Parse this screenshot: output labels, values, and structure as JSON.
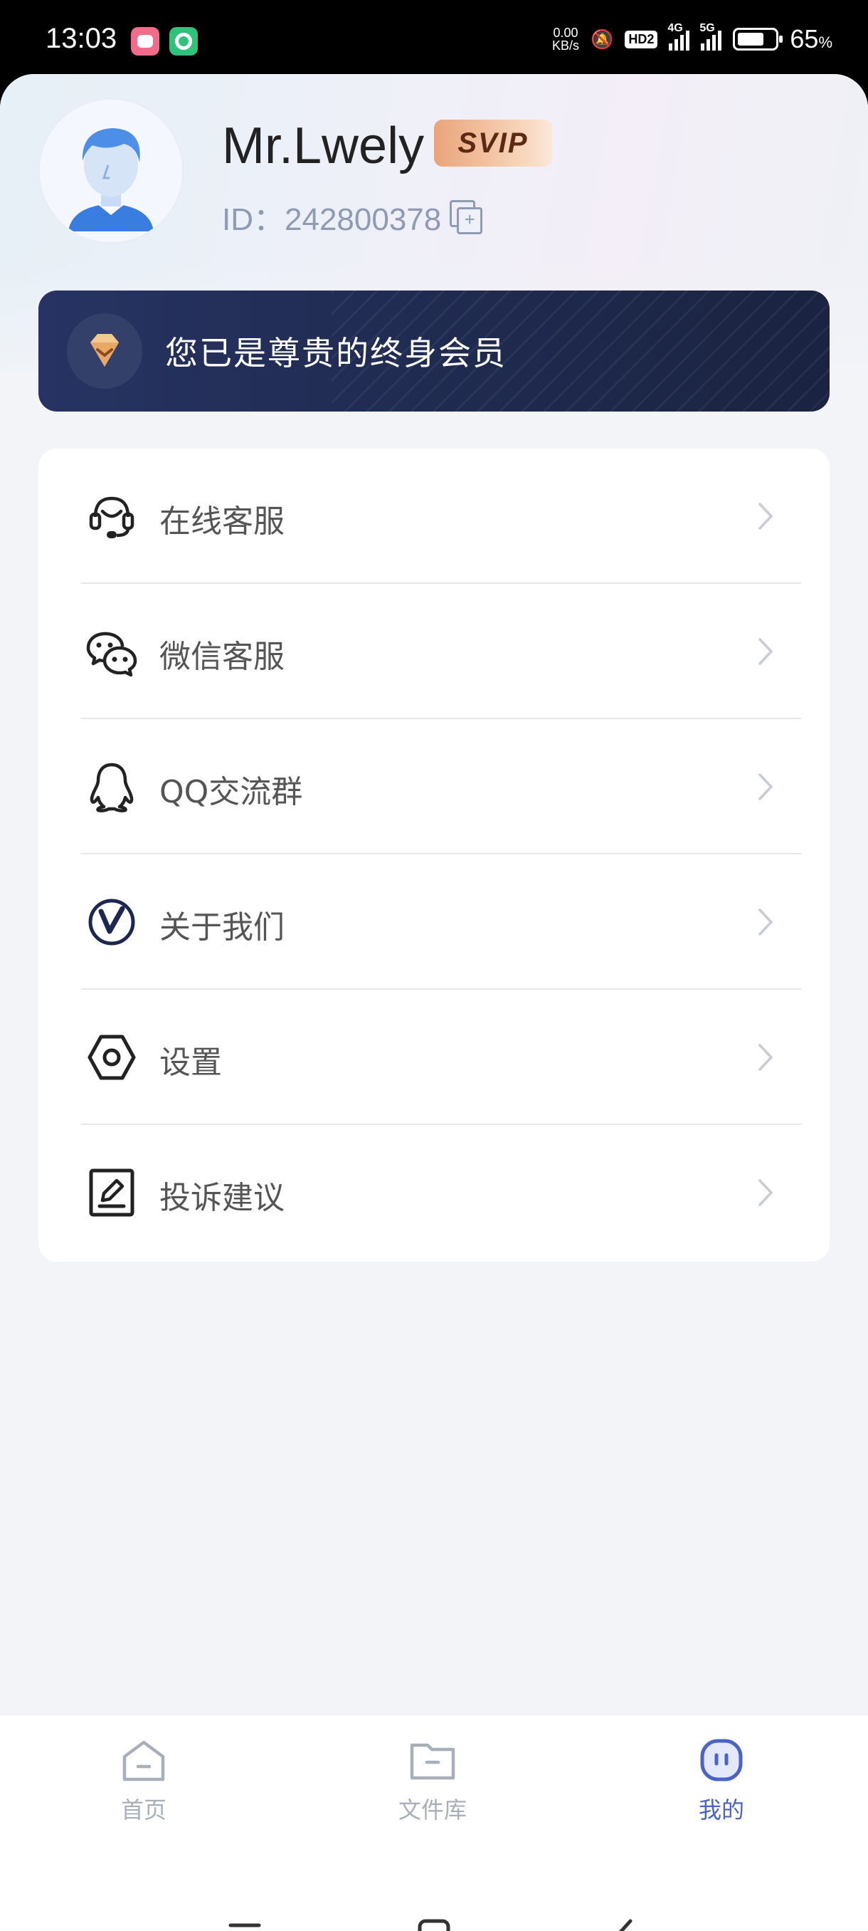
{
  "status_bar": {
    "time": "13:03",
    "net_speed_value": "0.00",
    "net_speed_unit": "KB/s",
    "hd_label": "HD2",
    "net1": "4G",
    "net2": "5G",
    "battery_percent": "65",
    "battery_unit": "%"
  },
  "profile": {
    "username": "Mr.Lwely",
    "badge": "SVIP",
    "user_id": "ID：242800378"
  },
  "vip_banner": {
    "text": "您已是尊贵的终身会员"
  },
  "menu": {
    "items": [
      {
        "label": "在线客服",
        "icon": "headset-icon"
      },
      {
        "label": "微信客服",
        "icon": "wechat-icon"
      },
      {
        "label": "QQ交流群",
        "icon": "qq-penguin-icon"
      },
      {
        "label": "关于我们",
        "icon": "logo-v-icon"
      },
      {
        "label": "设置",
        "icon": "hex-settings-icon"
      },
      {
        "label": "投诉建议",
        "icon": "edit-note-icon"
      }
    ]
  },
  "bottom_nav": {
    "items": [
      {
        "label": "首页",
        "icon": "home-icon",
        "active": false
      },
      {
        "label": "文件库",
        "icon": "folder-icon",
        "active": false
      },
      {
        "label": "我的",
        "icon": "profile-face-icon",
        "active": true
      }
    ]
  },
  "colors": {
    "accent": "#4a63c5",
    "vip_banner_bg": "#1f2a4f",
    "badge_gold": "#e9a57b",
    "text_muted": "#8f9bb0"
  }
}
